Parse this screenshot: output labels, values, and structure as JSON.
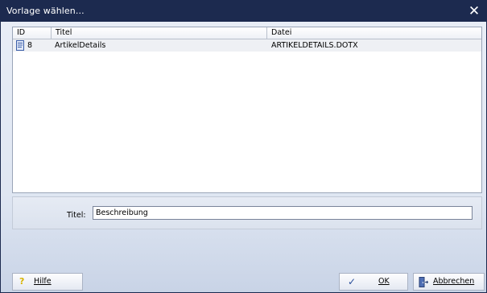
{
  "window": {
    "title": "Vorlage wählen...",
    "close_glyph": "✕"
  },
  "listview": {
    "columns": [
      "ID",
      "Titel",
      "Datei"
    ],
    "rows": [
      {
        "icon": "document-icon",
        "id": "8",
        "titel": "ArtikelDetails",
        "datei": "ARTIKELDETAILS.DOTX"
      }
    ]
  },
  "form": {
    "titel_label": "Titel:",
    "titel_value": "Beschreibung"
  },
  "buttons": {
    "help": {
      "icon": "help-icon",
      "glyph": "?",
      "label": "Hilfe"
    },
    "ok": {
      "icon": "checkmark-icon",
      "glyph": "✓",
      "label": "OK"
    },
    "cancel": {
      "icon": "exit-door-icon",
      "label": "Abbrechen"
    }
  },
  "colors": {
    "titlebar": "#1c2a4f",
    "selected_row": "#eef0f4",
    "help_icon": "#d8b400",
    "ok_icon": "#2a4f9a"
  }
}
